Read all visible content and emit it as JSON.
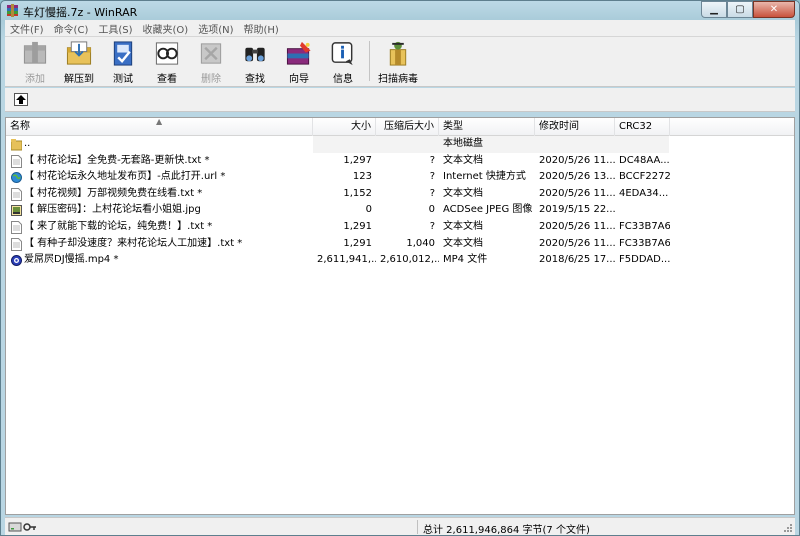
{
  "window": {
    "title": "车灯慢摇.7z - WinRAR"
  },
  "menu": [
    "文件(F)",
    "命令(C)",
    "工具(S)",
    "收藏夹(O)",
    "选项(N)",
    "帮助(H)"
  ],
  "toolbar": [
    {
      "label": "添加",
      "icon": "add-icon",
      "disabled": true
    },
    {
      "label": "解压到",
      "icon": "extract-icon",
      "disabled": false
    },
    {
      "label": "测试",
      "icon": "test-icon",
      "disabled": false
    },
    {
      "label": "查看",
      "icon": "view-icon",
      "disabled": false
    },
    {
      "label": "删除",
      "icon": "delete-icon",
      "disabled": true
    },
    {
      "label": "查找",
      "icon": "find-icon",
      "disabled": false
    },
    {
      "label": "向导",
      "icon": "wizard-icon",
      "disabled": false
    },
    {
      "label": "信息",
      "icon": "info-icon",
      "disabled": false
    },
    {
      "label": "扫描病毒",
      "icon": "virus-scan-icon",
      "disabled": false
    }
  ],
  "columns": {
    "name": "名称",
    "size": "大小",
    "packed": "压缩后大小",
    "type": "类型",
    "modified": "修改时间",
    "crc": "CRC32"
  },
  "files": [
    {
      "name": "..",
      "size": "",
      "packed": "",
      "type": "本地磁盘",
      "modified": "",
      "crc": "",
      "icon": "folder-icon"
    },
    {
      "name": "【 村花论坛】全免费-无套路-更新快.txt *",
      "size": "1,297",
      "packed": "?",
      "type": "文本文档",
      "modified": "2020/5/26 11...",
      "crc": "DC48AA...",
      "icon": "text-file-icon"
    },
    {
      "name": "【 村花论坛永久地址发布页】-点此打开.url *",
      "size": "123",
      "packed": "?",
      "type": "Internet 快捷方式",
      "modified": "2020/5/26 13...",
      "crc": "BCCF2272",
      "icon": "internet-shortcut-icon"
    },
    {
      "name": "【 村花视频】万部视频免费在线看.txt *",
      "size": "1,152",
      "packed": "?",
      "type": "文本文档",
      "modified": "2020/5/26 11...",
      "crc": "4EDA34...",
      "icon": "text-file-icon"
    },
    {
      "name": "【 解压密码】：上村花论坛看小姐姐.jpg",
      "size": "0",
      "packed": "0",
      "type": "ACDSee JPEG 图像",
      "modified": "2019/5/15 22...",
      "crc": "",
      "icon": "jpeg-image-icon"
    },
    {
      "name": "【 来了就能下载的论坛，纯免费！】.txt *",
      "size": "1,291",
      "packed": "?",
      "type": "文本文档",
      "modified": "2020/5/26 11...",
      "crc": "FC33B7A6",
      "icon": "text-file-icon"
    },
    {
      "name": "【 有种子却没速度？来村花论坛人工加速】.txt *",
      "size": "1,291",
      "packed": "1,040",
      "type": "文本文档",
      "modified": "2020/5/26 11...",
      "crc": "FC33B7A6",
      "icon": "text-file-icon"
    },
    {
      "name": "爱屌屄DJ慢摇.mp4 *",
      "size": "2,611,941,...",
      "packed": "2,610,012,...",
      "type": "MP4 文件",
      "modified": "2018/6/25 17...",
      "crc": "F5DDAD...",
      "icon": "mp4-video-icon"
    }
  ],
  "status": {
    "summary": "总计 2,611,946,864 字节(7 个文件)"
  }
}
